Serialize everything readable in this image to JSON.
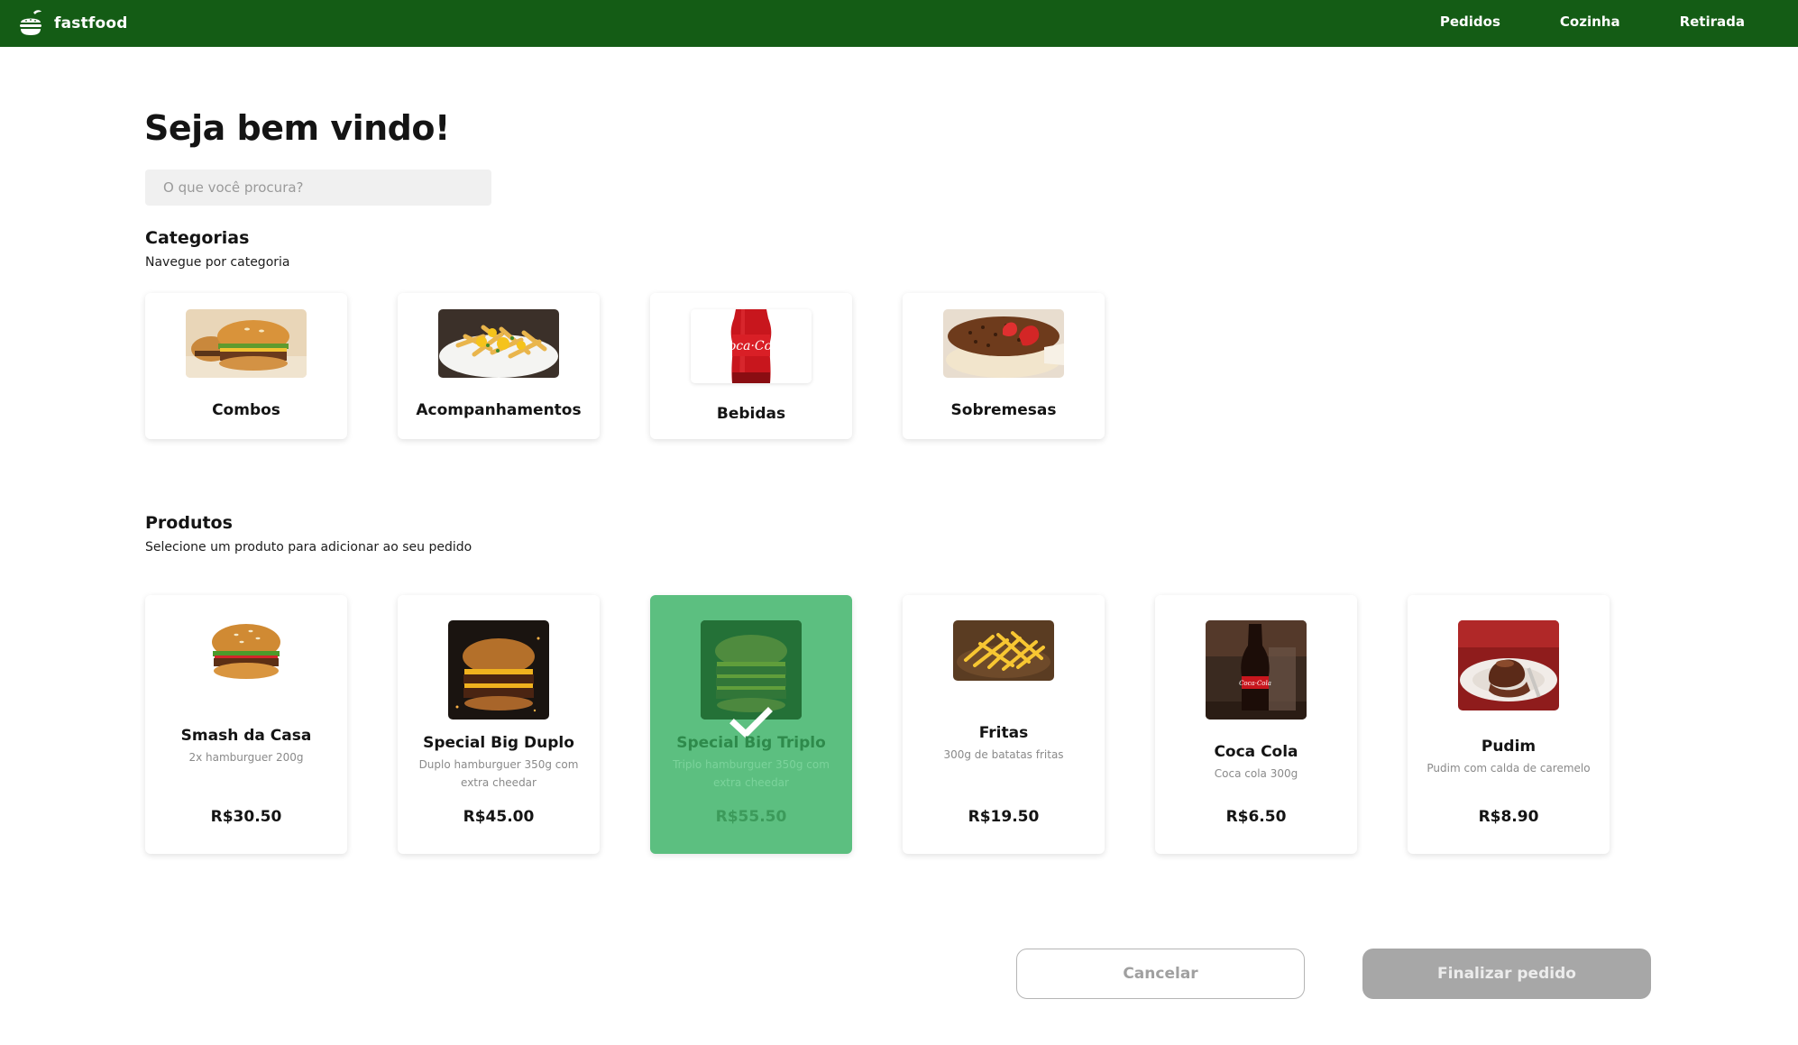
{
  "app": {
    "brand": "fastfood",
    "colors": {
      "header": "#145c15",
      "selected": "#5cbf80",
      "button_disabled": "#a7a7a7"
    }
  },
  "nav": [
    "Pedidos",
    "Cozinha",
    "Retirada"
  ],
  "welcome": "Seja bem vindo!",
  "search": {
    "placeholder": "O que você procura?",
    "value": ""
  },
  "categories": {
    "title": "Categorias",
    "subtitle": "Navegue por categoria",
    "items": [
      {
        "label": "Combos",
        "icon": "burger-photo"
      },
      {
        "label": "Acompanhamentos",
        "icon": "loaded-fries-photo"
      },
      {
        "label": "Bebidas",
        "icon": "coca-cola-bottle-photo"
      },
      {
        "label": "Sobremesas",
        "icon": "strawberry-cake-photo"
      }
    ]
  },
  "products": {
    "title": "Produtos",
    "subtitle": "Selecione um produto para adicionar ao seu pedido",
    "items": [
      {
        "name": "Smash da Casa",
        "desc": "2x hamburguer 200g",
        "price": "R$30.50",
        "selected": false,
        "icon": "burger-photo"
      },
      {
        "name": "Special Big Duplo",
        "desc": "Duplo hamburguer 350g com extra cheedar",
        "price": "R$45.00",
        "selected": false,
        "icon": "double-burger-photo"
      },
      {
        "name": "Special Big Triplo",
        "desc": "Triplo hamburguer 350g com extra cheedar",
        "price": "R$55.50",
        "selected": true,
        "icon": "triple-burger-photo"
      },
      {
        "name": "Fritas",
        "desc": "300g de batatas fritas",
        "price": "R$19.50",
        "selected": false,
        "icon": "fries-photo"
      },
      {
        "name": "Coca Cola",
        "desc": "Coca cola 300g",
        "price": "R$6.50",
        "selected": false,
        "icon": "coca-cola-photo"
      },
      {
        "name": "Pudim",
        "desc": "Pudim com calda de caremelo",
        "price": "R$8.90",
        "selected": false,
        "icon": "pudding-photo"
      }
    ]
  },
  "actions": {
    "cancel": "Cancelar",
    "finish": "Finalizar pedido"
  }
}
